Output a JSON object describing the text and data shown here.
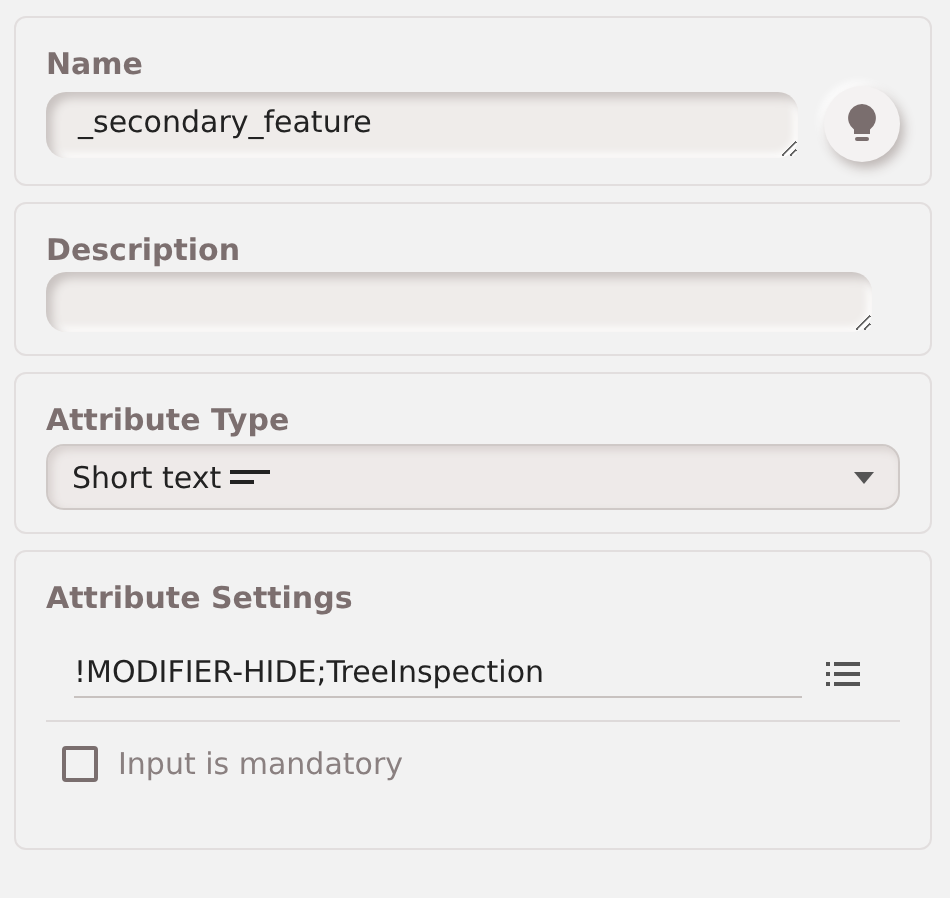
{
  "name": {
    "label": "Name",
    "value": "_secondary_feature"
  },
  "description": {
    "label": "Description"
  },
  "attribute_type": {
    "label": "Attribute Type",
    "value": "Short text"
  },
  "attribute_settings": {
    "label": "Attribute Settings",
    "value": "!MODIFIER-HIDE;TreeInspection",
    "mandatory": {
      "label": "Input is mandatory",
      "checked": false
    }
  }
}
